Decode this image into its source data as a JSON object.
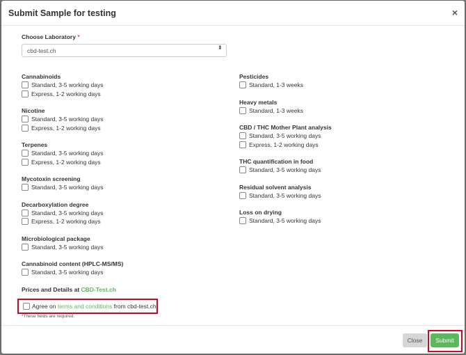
{
  "modal": {
    "title": "Submit Sample for testing",
    "close_icon": "×"
  },
  "laboratory": {
    "label": "Choose Laboratory",
    "required_mark": "*",
    "selected": "cbd-test.ch",
    "caret": "⬍"
  },
  "left_groups": [
    {
      "title": "Cannabinoids",
      "options": [
        "Standard, 3-5 working days",
        "Express, 1-2 working days"
      ]
    },
    {
      "title": "Nicotine",
      "options": [
        "Standard, 3-5 working days",
        "Express, 1-2 working days"
      ]
    },
    {
      "title": "Terpenes",
      "options": [
        "Standard, 3-5 working days",
        "Express, 1-2 working days"
      ]
    },
    {
      "title": "Mycotoxin screening",
      "options": [
        "Standard, 3-5 working days"
      ]
    },
    {
      "title": "Decarboxylation degree",
      "options": [
        "Standard, 3-5 working days",
        "Express, 1-2 working days"
      ]
    },
    {
      "title": "Microbiological package",
      "options": [
        "Standard, 3-5 working days"
      ]
    },
    {
      "title": "Cannabinoid content (HPLC-MS/MS)",
      "options": [
        "Standard, 3-5 working days"
      ]
    }
  ],
  "right_groups": [
    {
      "title": "Pesticides",
      "options": [
        "Standard, 1-3 weeks"
      ]
    },
    {
      "title": "Heavy metals",
      "options": [
        "Standard, 1-3 weeks"
      ]
    },
    {
      "title": "CBD / THC Mother Plant analysis",
      "options": [
        "Standard, 3-5 working days",
        "Express, 1-2 working days"
      ]
    },
    {
      "title": "THC quantification in food",
      "options": [
        "Standard, 3-5 working days"
      ]
    },
    {
      "title": "Residual solvent analysis",
      "options": [
        "Standard, 3-5 working days"
      ]
    },
    {
      "title": "Loss on drying",
      "options": [
        "Standard, 3-5 working days"
      ]
    }
  ],
  "prices": {
    "prefix": "Prices and Details at ",
    "link": "CBD-Test.ch"
  },
  "agree": {
    "prefix": "Agree on ",
    "link": "terms and conditions",
    "suffix": " from cbd-test.ch"
  },
  "footnote": "*These fields are required.",
  "footer": {
    "close_label": "Close",
    "submit_label": "Submit"
  }
}
